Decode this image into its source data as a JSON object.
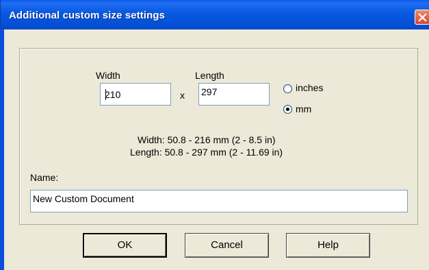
{
  "window": {
    "title": "Additional custom size settings"
  },
  "size": {
    "width_label": "Width",
    "length_label": "Length",
    "width_value": "210",
    "length_value": "297",
    "separator": "x"
  },
  "units": {
    "inches_label": "inches",
    "mm_label": "mm",
    "selected": "mm"
  },
  "ranges": {
    "width_range": "Width: 50.8 - 216 mm  (2 - 8.5 in)",
    "length_range": "Length: 50.8 - 297 mm  (2 - 11.69 in)"
  },
  "name": {
    "label": "Name:",
    "value": "New Custom Document"
  },
  "buttons": {
    "ok": "OK",
    "cancel": "Cancel",
    "help": "Help"
  }
}
